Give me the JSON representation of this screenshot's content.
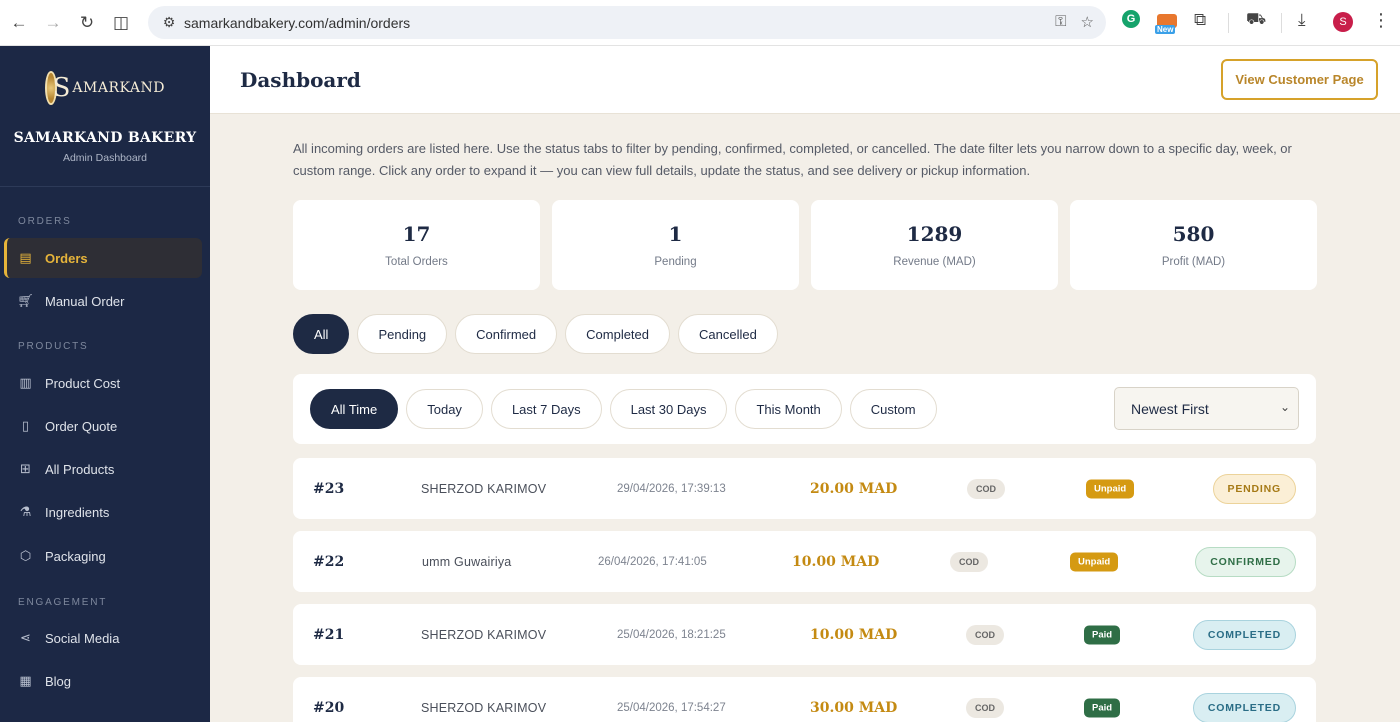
{
  "browser": {
    "url": "samarkandbakery.com/admin/orders",
    "ext_new_label": "New",
    "profile_initial": "S"
  },
  "sidebar": {
    "brand": "SAMARKAND BAKERY",
    "subtitle": "Admin Dashboard",
    "logo_text": "AMARKAND",
    "logo_initial": "S",
    "sections": [
      {
        "title": "ORDERS",
        "items": [
          {
            "label": "Orders",
            "icon": "clipboard-icon",
            "active": true
          },
          {
            "label": "Manual Order",
            "icon": "cart-icon"
          }
        ]
      },
      {
        "title": "PRODUCTS",
        "items": [
          {
            "label": "Product Cost",
            "icon": "receipt-icon"
          },
          {
            "label": "Order Quote",
            "icon": "document-icon"
          },
          {
            "label": "All Products",
            "icon": "grid-icon"
          },
          {
            "label": "Ingredients",
            "icon": "flask-icon"
          },
          {
            "label": "Packaging",
            "icon": "box-icon"
          }
        ]
      },
      {
        "title": "ENGAGEMENT",
        "items": [
          {
            "label": "Social Media",
            "icon": "share-icon"
          },
          {
            "label": "Blog",
            "icon": "newspaper-icon"
          }
        ]
      }
    ]
  },
  "header": {
    "title": "Dashboard",
    "view_customer_label": "View Customer Page"
  },
  "intro": "All incoming orders are listed here. Use the status tabs to filter by pending, confirmed, completed, or cancelled. The date filter lets you narrow down to a specific day, week, or custom range. Click any order to expand it — you can view full details, update the status, and see delivery or pickup information.",
  "stats": [
    {
      "value": "17",
      "label": "Total Orders"
    },
    {
      "value": "1",
      "label": "Pending"
    },
    {
      "value": "1289",
      "label": "Revenue (MAD)"
    },
    {
      "value": "580",
      "label": "Profit (MAD)"
    }
  ],
  "status_tabs": [
    "All",
    "Pending",
    "Confirmed",
    "Completed",
    "Cancelled"
  ],
  "status_tab_active": "All",
  "date_tabs": [
    "All Time",
    "Today",
    "Last 7 Days",
    "Last 30 Days",
    "This Month",
    "Custom"
  ],
  "date_tab_active": "All Time",
  "sort": {
    "selected": "Newest First"
  },
  "orders": [
    {
      "id": "#23",
      "name": "SHERZOD KARIMOV",
      "date": "29/04/2026, 17:39:13",
      "total": "20.00 MAD",
      "method": "COD",
      "payment": "Unpaid",
      "status": "PENDING"
    },
    {
      "id": "#22",
      "name": "umm Guwairiya",
      "date": "26/04/2026, 17:41:05",
      "total": "10.00 MAD",
      "method": "COD",
      "payment": "Unpaid",
      "status": "CONFIRMED"
    },
    {
      "id": "#21",
      "name": "SHERZOD KARIMOV",
      "date": "25/04/2026, 18:21:25",
      "total": "10.00 MAD",
      "method": "COD",
      "payment": "Paid",
      "status": "COMPLETED"
    },
    {
      "id": "#20",
      "name": "SHERZOD KARIMOV",
      "date": "25/04/2026, 17:54:27",
      "total": "30.00 MAD",
      "method": "COD",
      "payment": "Paid",
      "status": "COMPLETED"
    }
  ],
  "colors": {
    "navy": "#1c2845",
    "gold": "#d6a22a",
    "paid": "#2f6e46",
    "unpaid": "#d59a12"
  }
}
